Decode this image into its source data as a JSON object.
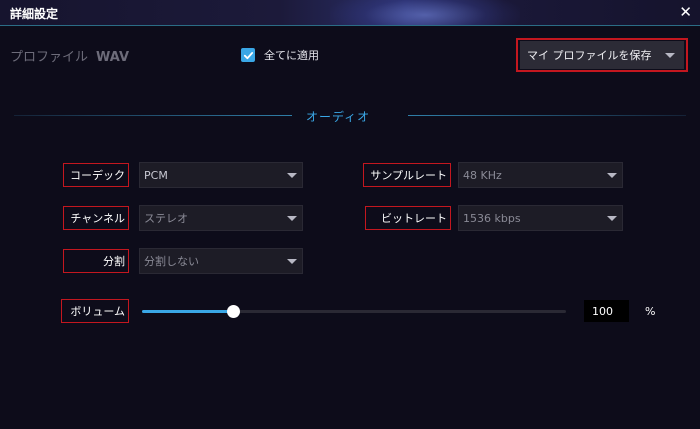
{
  "window": {
    "title": "詳細設定",
    "close_glyph": "✕"
  },
  "profile": {
    "label": "プロファイル",
    "value": "WAV"
  },
  "apply_all": {
    "label": "全てに適用",
    "checked": true
  },
  "save_profile": {
    "label": "マイ プロファイルを保存"
  },
  "section": {
    "title": "オーディオ"
  },
  "codec": {
    "label": "コーデック",
    "value": "PCM"
  },
  "sample_rate": {
    "label": "サンプルレート",
    "value": "48 KHz"
  },
  "channel": {
    "label": "チャンネル",
    "value": "ステレオ"
  },
  "bitrate": {
    "label": "ビットレート",
    "value": "1536 kbps"
  },
  "split": {
    "label": "分割",
    "value": "分割しない"
  },
  "volume": {
    "label": "ボリューム",
    "value": "100",
    "unit": "%",
    "level": 0.214
  },
  "colors": {
    "accent": "#3aa7e6",
    "highlight_border": "#c3171f",
    "background": "#0d0c1a"
  }
}
